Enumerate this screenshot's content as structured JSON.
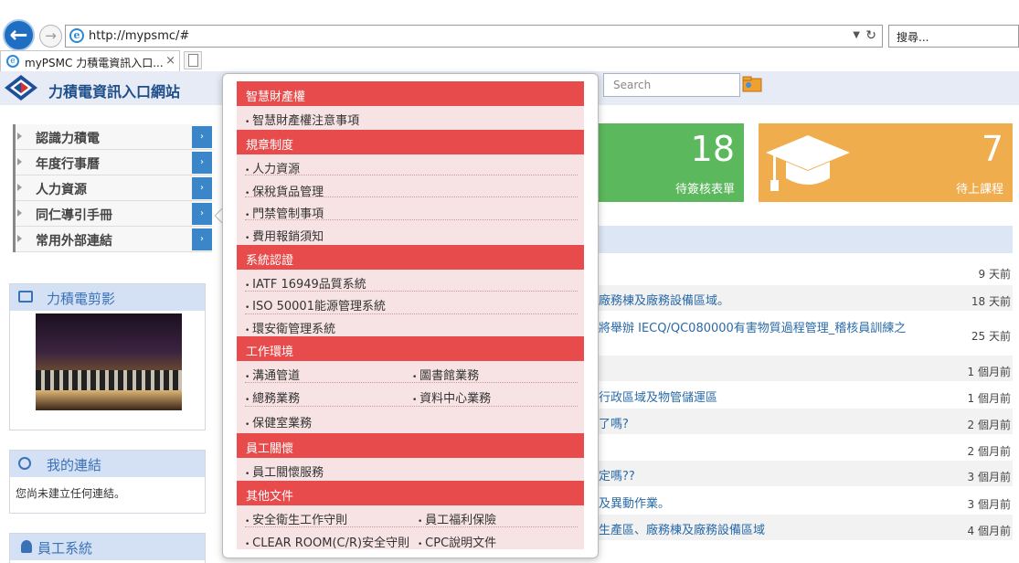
{
  "browser": {
    "url": "http://mypsmc/#",
    "search_placeholder": "搜尋...",
    "tab_title": "myPSMC 力積電資訊入口...",
    "tab_close": "×"
  },
  "header": {
    "site_title": "力積電資訊入口網站",
    "search_placeholder": "Search"
  },
  "leftnav": {
    "items": [
      {
        "label": "認識力積電"
      },
      {
        "label": "年度行事曆"
      },
      {
        "label": "人力資源"
      },
      {
        "label": "同仁導引手冊"
      },
      {
        "label": "常用外部連結"
      }
    ]
  },
  "panels": {
    "photo_title": "力積電剪影",
    "links_title": "我的連結",
    "links_empty": "您尚未建立任何連結。",
    "employee_title": "員工系統"
  },
  "cards": {
    "sign": {
      "count": "18",
      "label": "待簽核表單"
    },
    "course": {
      "count": "7",
      "label": "待上課程"
    }
  },
  "news": [
    {
      "title": "",
      "time": "9 天前"
    },
    {
      "title": "廠務棟及廠務設備區域。",
      "time": "18 天前"
    },
    {
      "title": "將舉辦 IECQ/QC080000有害物質過程管理_稽核員訓練之",
      "time": "25 天前"
    },
    {
      "title": "",
      "time": "1 個月前"
    },
    {
      "title": "行政區域及物管儲運區",
      "time": "1 個月前"
    },
    {
      "title": "了嗎?",
      "time": "2 個月前"
    },
    {
      "title": "",
      "time": "2 個月前"
    },
    {
      "title": "定嗎??",
      "time": "3 個月前"
    },
    {
      "title": "及異動作業。",
      "time": "3 個月前"
    },
    {
      "title": "生產區、廠務棟及廠務設備區域",
      "time": "4 個月前"
    }
  ],
  "menu": {
    "cat1": "智慧財產權",
    "cat1_items": [
      "智慧財產權注意事項"
    ],
    "cat2": "規章制度",
    "cat2_items": [
      "人力資源",
      "保稅貨品管理",
      "門禁管制事項",
      "費用報銷須知"
    ],
    "cat3": "系統認證",
    "cat3_items": [
      "IATF 16949品質系統",
      "ISO 50001能源管理系統",
      "環安衛管理系統"
    ],
    "cat4": "工作環境",
    "cat4_items": [
      "溝通管道",
      "圖書館業務",
      "總務業務",
      "資料中心業務",
      "保健室業務"
    ],
    "cat5": "員工關懷",
    "cat5_items": [
      "員工關懷服務"
    ],
    "cat6": "其他文件",
    "cat6_items": [
      "安全衛生工作守則",
      "員工福利保險",
      "CLEAR ROOM(C/R)安全守則",
      "CPC說明文件"
    ]
  },
  "colors": {
    "menu_category": "#e84b4b",
    "menu_item_bg": "#f7e3e3",
    "green_card": "#5cb85c",
    "orange_card": "#f0ad4e"
  }
}
